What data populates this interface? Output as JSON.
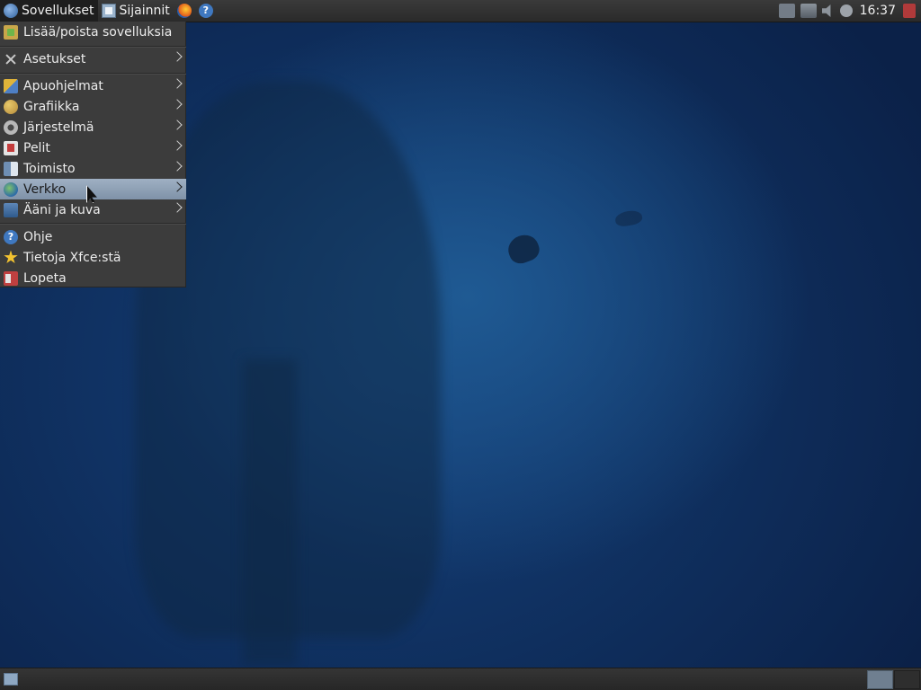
{
  "top_panel": {
    "apps_menu_label": "Sovellukset",
    "places_label": "Sijainnit",
    "clock": "16:37"
  },
  "apps_menu": {
    "items": [
      {
        "label": "Lisää/poista sovelluksia",
        "icon": "add-remove-software-icon",
        "submenu": false
      },
      {
        "label": "Asetukset",
        "icon": "settings-icon",
        "submenu": true
      },
      {
        "label": "Apuohjelmat",
        "icon": "accessories-icon",
        "submenu": true
      },
      {
        "label": "Grafiikka",
        "icon": "graphics-icon",
        "submenu": true
      },
      {
        "label": "Järjestelmä",
        "icon": "system-icon",
        "submenu": true
      },
      {
        "label": "Pelit",
        "icon": "games-icon",
        "submenu": true
      },
      {
        "label": "Toimisto",
        "icon": "office-icon",
        "submenu": true
      },
      {
        "label": "Verkko",
        "icon": "network-icon",
        "submenu": true,
        "highlighted": true
      },
      {
        "label": "Ääni ja kuva",
        "icon": "multimedia-icon",
        "submenu": true
      },
      {
        "label": "Ohje",
        "icon": "help-icon",
        "submenu": false
      },
      {
        "label": "Tietoja Xfce:stä",
        "icon": "star-icon",
        "submenu": false
      },
      {
        "label": "Lopeta",
        "icon": "logout-icon",
        "submenu": false
      }
    ]
  },
  "colors": {
    "panel": "#2f2f2f",
    "menu_bg": "#3c3c3c",
    "highlight": "#8fa1b6",
    "desktop": "#15407a"
  }
}
